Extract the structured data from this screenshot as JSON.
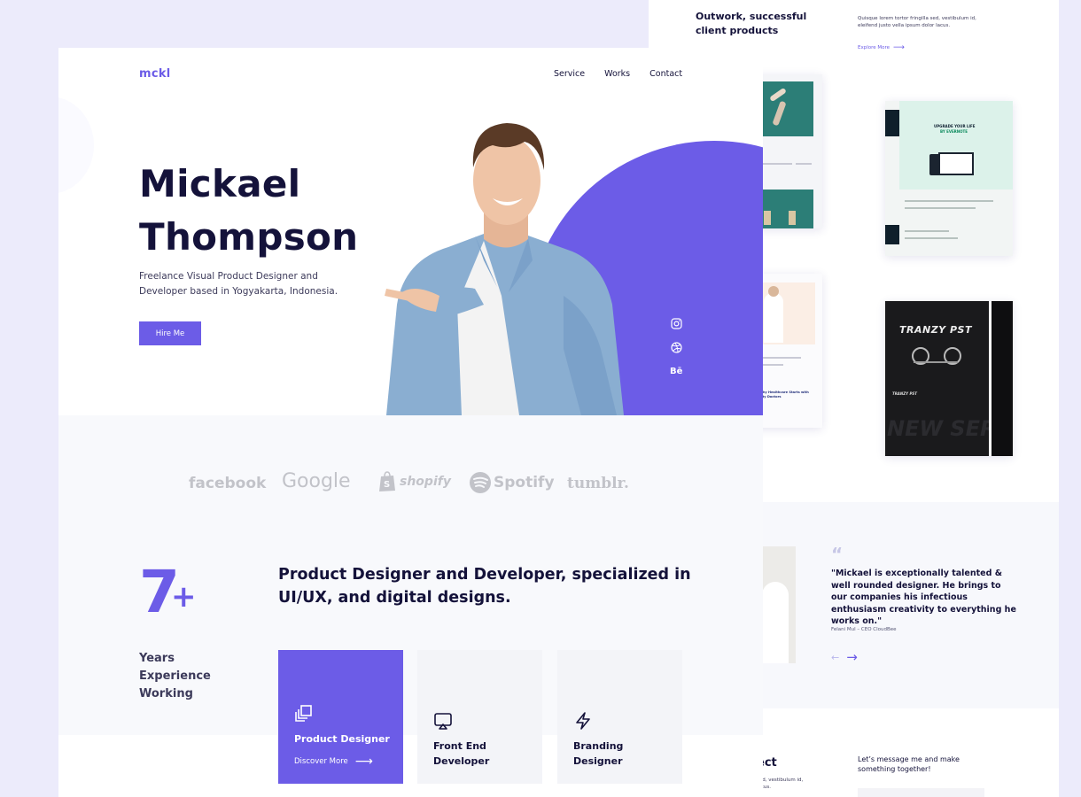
{
  "back": {
    "top_title": "Outwork, successful client products",
    "top_text": "Quisque lorem tortor fringilla sed, vestibulum id, eleifend justo vella ipsum dolor lacus.",
    "explore": "Explore More",
    "thumbs": {
      "upgrade_title": "UPGRADE YOUR LIFE",
      "upgrade_sub": "BY EVERNOTE",
      "doctor_text": "Healthy Healthcare Starts with Quality Doctors",
      "tranzy_title": "TRANZY PST",
      "tranzy_sub": "TRANZY PST",
      "tranzy_big": "NEW SERI"
    },
    "testimonial": {
      "quote_mark": "“",
      "text": "\"Mickael is exceptionally talented & well rounded designer. He brings to our companies his infectious enthusiasm creativity to everything he works on.\"",
      "author": "Felani Mul – CEO CloudBee",
      "prev": "←",
      "next": "→"
    },
    "contact": {
      "title_fragment": "ect",
      "small_text": "sed, vestibulum id, lacus.",
      "text": "Let’s message me and make something together!"
    }
  },
  "nav": {
    "logo": "mckl",
    "links": [
      "Service",
      "Works",
      "Contact"
    ]
  },
  "hero": {
    "first_name": "Mickael",
    "last_name": "Thompson",
    "subtitle": "Freelance  Visual Product Designer and Developer based in Yogyakarta, Indonesia.",
    "cta": "Hire Me"
  },
  "social": [
    "instagram-icon",
    "dribbble-icon",
    "behance-icon"
  ],
  "logos": [
    "facebook",
    "Google",
    "shopify",
    "Spotify",
    "tumblr."
  ],
  "experience": {
    "number": "7",
    "plus": "+",
    "label": "Years Experience Working"
  },
  "headline": "Product Designer and Developer, specialized in UI/UX, and digital designs.",
  "services": [
    {
      "title": "Product Designer",
      "icon": "layers-icon",
      "link": "Discover More",
      "active": true
    },
    {
      "title": "Front End Developer",
      "icon": "monitor-icon",
      "active": false
    },
    {
      "title": "Branding Designer",
      "icon": "lightning-icon",
      "active": false
    }
  ],
  "colors": {
    "accent": "#6c5ce7",
    "text_dark": "#14123a",
    "background": "#ecebfb"
  }
}
